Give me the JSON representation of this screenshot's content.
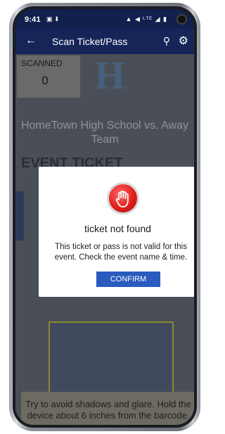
{
  "status_bar": {
    "time": "9:41",
    "left_icons": "▣ ⬇",
    "right_icons": "▲ ◀ ᴸᵀᴱ ◢ ▮"
  },
  "app_bar": {
    "title": "Scan Ticket/Pass",
    "back_icon": "←",
    "search_icon": "⚲",
    "settings_icon": "⚙"
  },
  "scanned": {
    "label": "SCANNED",
    "count": "0"
  },
  "logo_letter": "H",
  "event": {
    "title": "HomeTown High School vs. Away Team",
    "ticket_heading": "EVENT TICKET"
  },
  "hint": {
    "text": "Try to avoid shadows and glare. Hold the device about 6 inches from the barcode."
  },
  "dialog": {
    "icon": "stop-hand-icon",
    "title": "ticket not found",
    "message": "This ticket or pass is not valid for this event. Check the event name & time.",
    "confirm_label": "CONFIRM"
  },
  "colors": {
    "app_bar": "#152558",
    "confirm_button": "#2a5bbf",
    "stop_icon": "#e0201c"
  }
}
